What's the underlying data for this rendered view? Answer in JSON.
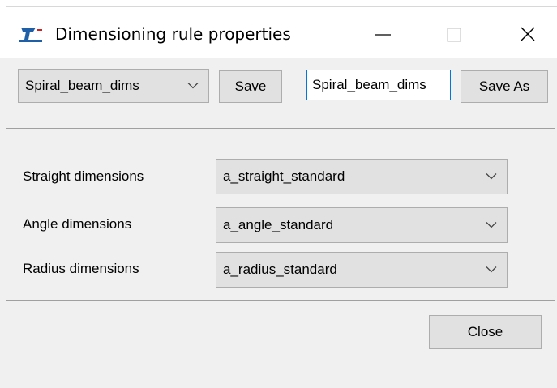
{
  "window": {
    "title": "Dimensioning rule properties"
  },
  "toolbar": {
    "rule_select_value": "Spiral_beam_dims",
    "save_label": "Save",
    "name_input_value": "Spiral_beam_dims",
    "save_as_label": "Save As"
  },
  "fields": [
    {
      "label": "Straight dimensions",
      "value": "a_straight_standard"
    },
    {
      "label": "Angle dimensions",
      "value": "a_angle_standard"
    },
    {
      "label": "Radius dimensions",
      "value": "a_radius_standard"
    }
  ],
  "footer": {
    "close_label": "Close"
  },
  "colors": {
    "input_focus_border": "#0078d7",
    "icon_blue": "#1f5fa8",
    "icon_red": "#cc2222"
  }
}
